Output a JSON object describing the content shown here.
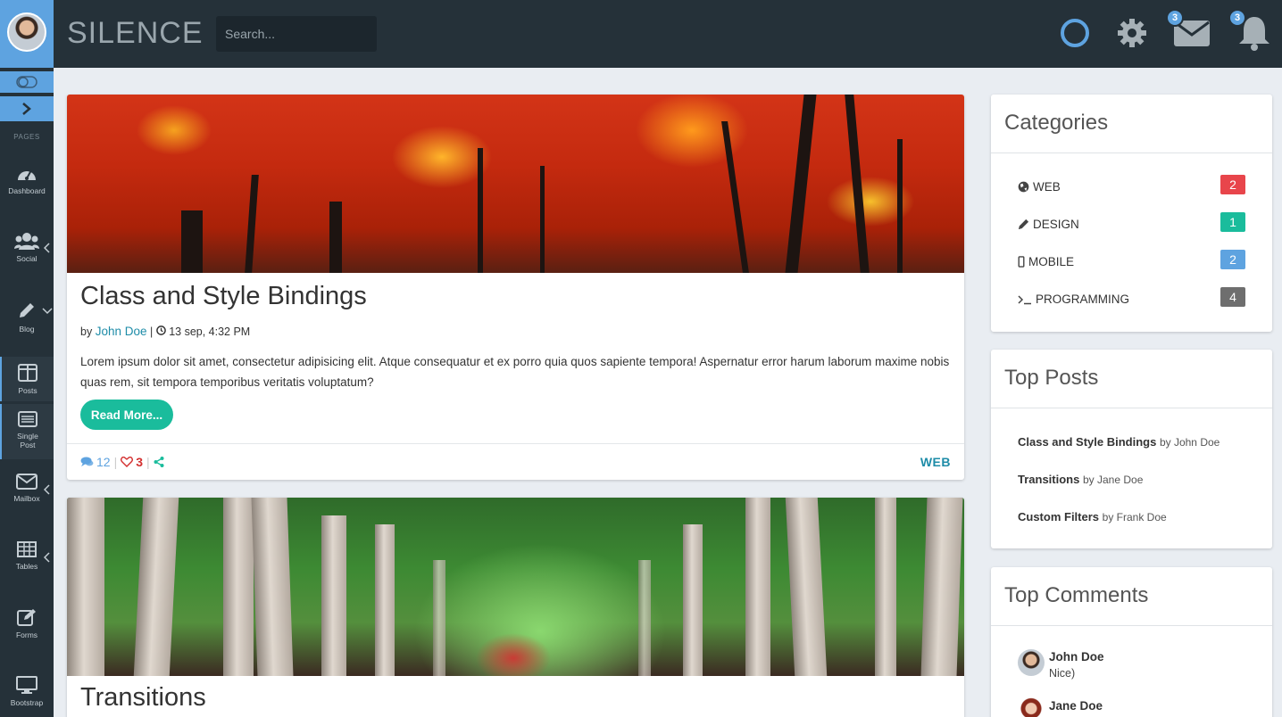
{
  "header": {
    "brand": "SILENCE",
    "search_placeholder": "Search...",
    "mail_badge": "3",
    "notif_badge": "3",
    "colors": {
      "header_bg": "#253139",
      "accent": "#5ea3e0"
    }
  },
  "sidebar": {
    "section_label": "PAGES",
    "items": [
      {
        "label": "Dashboard",
        "icon": "dashboard-icon"
      },
      {
        "label": "Social",
        "icon": "users-icon"
      },
      {
        "label": "Blog",
        "icon": "pencil-icon"
      },
      {
        "label": "Posts",
        "icon": "columns-icon"
      },
      {
        "label": "Single Post",
        "icon": "list-icon"
      },
      {
        "label": "Mailbox",
        "icon": "envelope-icon"
      },
      {
        "label": "Tables",
        "icon": "table-icon"
      },
      {
        "label": "Forms",
        "icon": "edit-icon"
      },
      {
        "label": "Bootstrap",
        "icon": "monitor-icon"
      }
    ]
  },
  "posts": [
    {
      "title": "Class and Style Bindings",
      "by": "by",
      "author": "John Doe",
      "date": "13 sep, 4:32 PM",
      "excerpt": "Lorem ipsum dolor sit amet, consectetur adipisicing elit. Atque consequatur et ex porro quia quos sapiente tempora! Aspernatur error harum laborum maxime nobis quas rem, sit tempora temporibus veritatis voluptatum?",
      "read_more": "Read More...",
      "comments": "12",
      "likes": "3",
      "tag": "WEB"
    },
    {
      "title": "Transitions"
    }
  ],
  "categories": {
    "title": "Categories",
    "items": [
      {
        "label": "WEB",
        "count": "2",
        "color": "#e8454b"
      },
      {
        "label": "DESIGN",
        "count": "1",
        "color": "#1abc9c"
      },
      {
        "label": "MOBILE",
        "count": "2",
        "color": "#5ea3e0"
      },
      {
        "label": "PROGRAMMING",
        "count": "4",
        "color": "#6e6e6e"
      }
    ]
  },
  "top_posts": {
    "title": "Top Posts",
    "items": [
      {
        "title": "Class and Style Bindings",
        "by": "by John Doe"
      },
      {
        "title": "Transitions",
        "by": "by Jane Doe"
      },
      {
        "title": "Custom Filters",
        "by": "by Frank Doe"
      }
    ]
  },
  "top_comments": {
    "title": "Top Comments",
    "items": [
      {
        "name": "John Doe",
        "text": "Nice)"
      },
      {
        "name": "Jane Doe",
        "text": ""
      }
    ]
  }
}
